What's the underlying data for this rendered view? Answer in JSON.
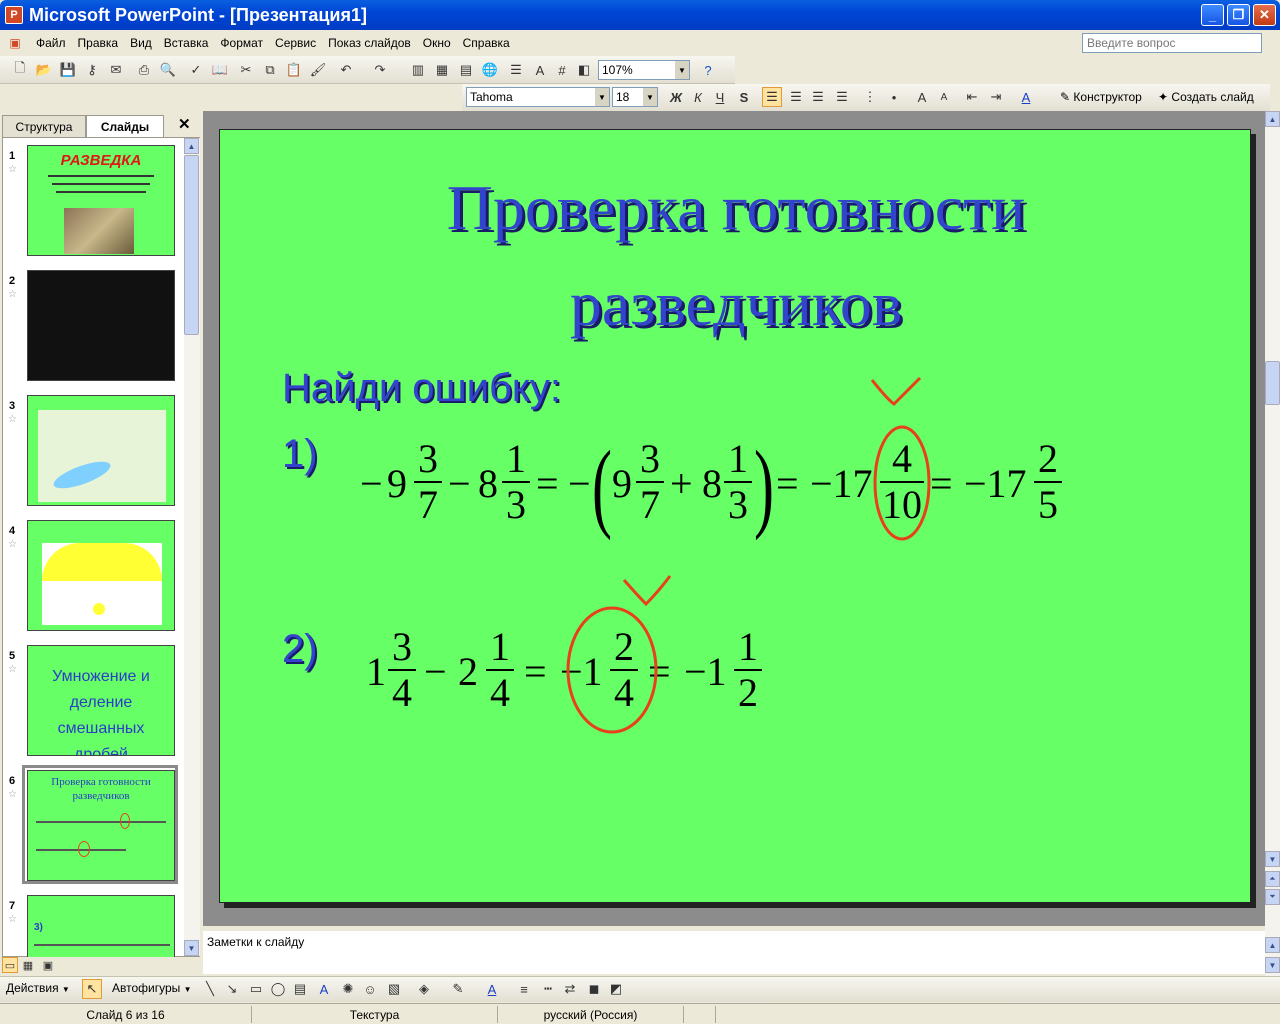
{
  "window": {
    "title": "Microsoft PowerPoint - [Презентация1]"
  },
  "menu": {
    "items": [
      "Файл",
      "Правка",
      "Вид",
      "Вставка",
      "Формат",
      "Сервис",
      "Показ слайдов",
      "Окно",
      "Справка"
    ],
    "ask_placeholder": "Введите вопрос"
  },
  "toolbar": {
    "zoom": "107%",
    "font": "Tahoma",
    "font_size": "18",
    "bold": "Ж",
    "italic": "К",
    "underline": "Ч",
    "shadow": "S",
    "designer": "Конструктор",
    "new_slide": "Создать слайд"
  },
  "panel": {
    "tabs": [
      "Структура",
      "Слайды"
    ],
    "thumbnails": [
      {
        "num": "1",
        "text": "РАЗВЕДКА"
      },
      {
        "num": "2",
        "text": ""
      },
      {
        "num": "3",
        "text": ""
      },
      {
        "num": "4",
        "text": ""
      },
      {
        "num": "5",
        "text": "Умножение и деление смешанных дробей"
      },
      {
        "num": "6",
        "text": "Проверка готовности разведчиков"
      },
      {
        "num": "7",
        "text": "3)"
      }
    ]
  },
  "slide": {
    "title_line1": "Проверка готовности",
    "title_line2": "разведчиков",
    "subtitle": "Найди ошибку:",
    "label1": "1)",
    "label2": "2)",
    "eq1": {
      "t1_sign": "−",
      "t1_whole": "9",
      "t1_num": "3",
      "t1_den": "7",
      "t2_sign": "−",
      "t2_whole": "8",
      "t2_num": "1",
      "t2_den": "3",
      "eq_a": "=",
      "neg": "−",
      "lp": "(",
      "t3_whole": "9",
      "t3_num": "3",
      "t3_den": "7",
      "plus": "+",
      "t4_whole": "8",
      "t4_num": "1",
      "t4_den": "3",
      "rp": ")",
      "eq_b": "=",
      "r1_whole": "−17",
      "r1_num": "4",
      "r1_den": "10",
      "eq_c": "=",
      "r2_whole": "−17",
      "r2_num": "2",
      "r2_den": "5"
    },
    "eq2": {
      "t1_whole": "1",
      "t1_num": "3",
      "t1_den": "4",
      "minus": "−",
      "t2_whole": "2",
      "t2_num": "1",
      "t2_den": "4",
      "eq_a": "=",
      "r1_whole": "−1",
      "r1_num": "2",
      "r1_den": "4",
      "eq_b": "=",
      "r2_whole": "−1",
      "r2_num": "1",
      "r2_den": "2"
    }
  },
  "notes": {
    "placeholder": "Заметки к слайду"
  },
  "drawing": {
    "actions": "Действия",
    "autoshapes": "Автофигуры"
  },
  "status": {
    "slide": "Слайд 6 из 16",
    "design": "Текстура",
    "language": "русский (Россия)"
  },
  "colors": {
    "slide_bg": "#66ff66",
    "title": "#3344cc",
    "mark": "#e8401c"
  }
}
